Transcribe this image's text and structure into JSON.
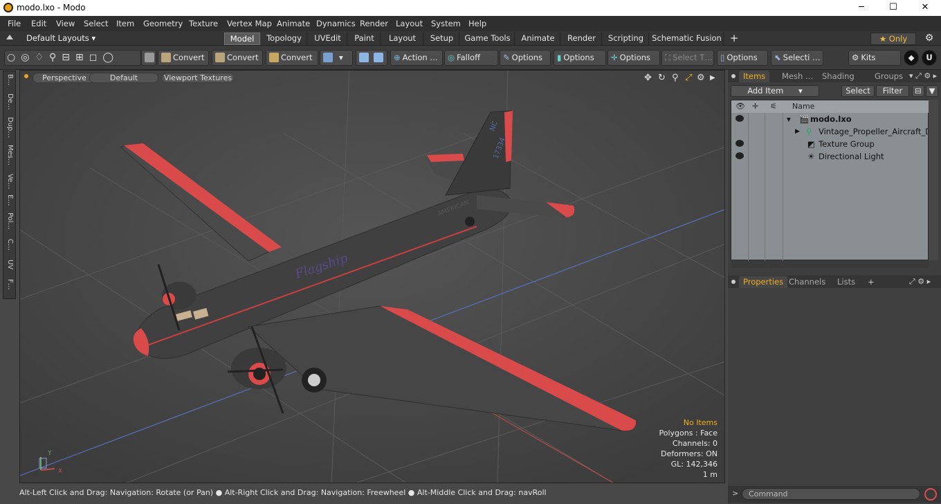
{
  "window": {
    "title": "modo.lxo - Modo",
    "min": "─",
    "max": "☐",
    "close": "✕"
  },
  "menu": [
    "File",
    "Edit",
    "View",
    "Select",
    "Item",
    "Geometry",
    "Texture",
    "Vertex Map",
    "Animate",
    "Dynamics",
    "Render",
    "Layout",
    "System",
    "Help"
  ],
  "layouts": {
    "label": "Default Layouts ▾"
  },
  "tabs": [
    "Model",
    "Topology",
    "UVEdit",
    "Paint",
    "Layout",
    "Setup",
    "Game Tools",
    "Animate",
    "Render",
    "Scripting",
    "Schematic Fusion"
  ],
  "tabs_plus": "+",
  "only": {
    "label": "★  Only"
  },
  "toolbar": {
    "convert1": "Convert",
    "convert2": "Convert",
    "convert3": "Convert",
    "action": "Action  …",
    "falloff": "Falloff",
    "options1": "Options",
    "options2": "Options",
    "options3": "Options",
    "select_t": "Select T…",
    "options4": "Options",
    "selecti": "Selecti …",
    "kits": "Kits"
  },
  "left_tabs": [
    "B…",
    "De…",
    "Dup…",
    "Mes…",
    "Ve…",
    "E…",
    "Pol…",
    "C…",
    "UV",
    "F…"
  ],
  "viewport": {
    "tab_perspective": "Perspective",
    "tab_default": "Default",
    "tab_textures": "Viewport Textures",
    "stats": {
      "no_items": "No Items",
      "polygons": "Polygons : Face",
      "channels": "Channels: 0",
      "deformers": "Deformers: ON",
      "gl": "GL: 142,346",
      "scale": "1 m"
    },
    "plane_text": {
      "flagship": "Flagship",
      "nc": "NC",
      "reg": "17334",
      "american": "AMERICAN"
    },
    "axis": {
      "y": "Y",
      "x": "X"
    }
  },
  "statusbar": "Alt-Left Click and Drag: Navigation: Rotate (or Pan) ● Alt-Right Click and Drag: Navigation: Freewheel ● Alt-Middle Click and Drag: navRoll",
  "items_panel": {
    "tabs": [
      "Items",
      "Mesh …",
      "Shading",
      "Groups"
    ],
    "add_item": "Add Item",
    "select": "Select",
    "filter": "Filter",
    "name_header": "Name",
    "rows": [
      {
        "label": "modo.lxo"
      },
      {
        "label": "Vintage_Propeller_Aircraft_Do…"
      },
      {
        "label": "Texture Group"
      },
      {
        "label": "Directional Light"
      }
    ]
  },
  "props_panel": {
    "tabs": [
      "Properties",
      "Channels",
      "Lists"
    ],
    "plus": "+"
  },
  "command": {
    "placeholder": "Command",
    "prompt": ">"
  },
  "colors": {
    "accent": "#f0b020",
    "plane_body": "#3f3f3f",
    "plane_trim": "#d94a4a"
  }
}
